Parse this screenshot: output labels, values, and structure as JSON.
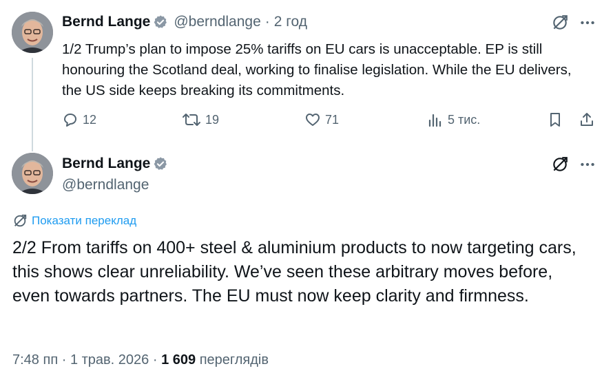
{
  "tweet1": {
    "author_name": "Bernd Lange",
    "handle": "@berndlange",
    "separator": "·",
    "time_ago": "2 год",
    "text": "1/2 Trump’s plan to impose 25% tariffs on EU cars is unacceptable. EP is still honouring the Scotland deal, working to finalise legislation. While the EU delivers, the US side keeps breaking its commitments.",
    "reply_count": "12",
    "retweet_count": "19",
    "like_count": "71",
    "views_count": "5 тис."
  },
  "tweet2": {
    "author_name": "Bernd Lange",
    "handle": "@berndlange",
    "translate_label": "Показати переклад",
    "text": "2/2 From tariffs on 400+ steel & aluminium products to now targeting cars, this shows clear unreliability. We’ve seen these arbitrary moves before, even towards partners. The EU must now keep clarity and firmness.",
    "time": "7:48 пп",
    "separator": "·",
    "date": "1 трав. 2026",
    "views_number": "1 609",
    "views_label": "переглядів"
  },
  "colors": {
    "accent": "#1d9bf0",
    "secondary_text": "#536471",
    "primary_text": "#0f1419",
    "thread_line": "#cfd9de"
  }
}
